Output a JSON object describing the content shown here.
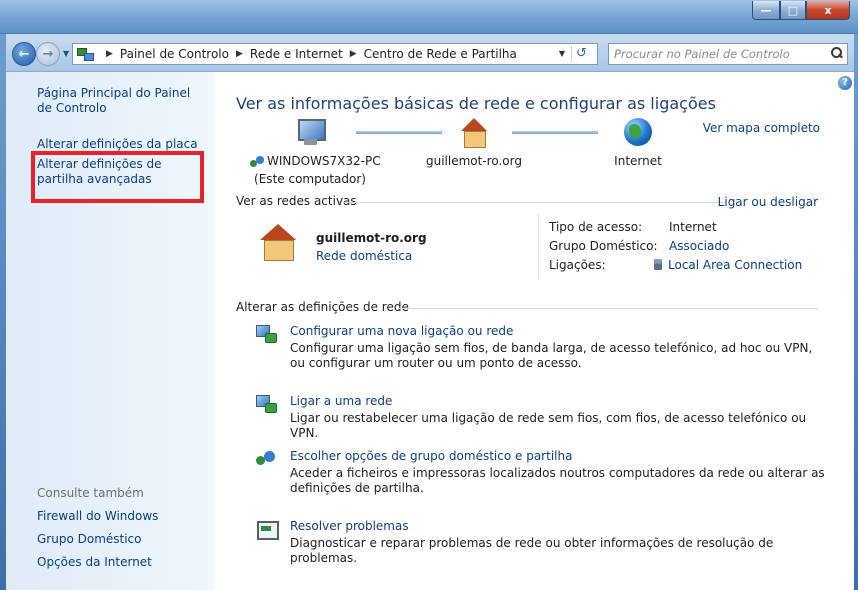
{
  "window": {
    "min_label": "",
    "max_label": "",
    "close_label": "x"
  },
  "address": {
    "crumbs": [
      "Painel de Controlo",
      "Rede e Internet",
      "Centro de Rede e Partilha"
    ],
    "search_placeholder": "Procurar no Painel de Controlo"
  },
  "left": {
    "home": "Página Principal do Painel de Controlo",
    "adapter": "Alterar definições da placa",
    "advanced": "Alterar definições de partilha avançadas",
    "see_also": "Consulte também",
    "links": [
      "Firewall do Windows",
      "Grupo Doméstico",
      "Opções da Internet"
    ]
  },
  "main": {
    "heading": "Ver as informações básicas de rede e configurar as ligações",
    "full_map": "Ver mapa completo",
    "nodes": {
      "pc_name": "WINDOWS7X32-PC",
      "pc_sub": "(Este computador)",
      "network": "guillemot-ro.org",
      "internet": "Internet"
    },
    "active_label": "Ver as redes activas",
    "connect_link": "Ligar ou desligar",
    "active": {
      "name": "guillemot-ro.org",
      "type": "Rede doméstica",
      "access_key": "Tipo de acesso:",
      "access_val": "Internet",
      "group_key": "Grupo Doméstico:",
      "group_val": "Associado",
      "conn_key": "Ligações:",
      "conn_val": "Local Area Connection"
    },
    "change_label": "Alterar as definições de rede",
    "tasks": [
      {
        "title": "Configurar uma nova ligação ou rede",
        "desc": "Configurar uma ligação sem fios, de banda larga, de acesso telefónico, ad hoc ou VPN, ou configurar um router ou um ponto de acesso."
      },
      {
        "title": "Ligar a uma rede",
        "desc": "Ligar ou restabelecer uma ligação de rede sem fios, com fios, de acesso telefónico ou VPN."
      },
      {
        "title": "Escolher opções de grupo doméstico e partilha",
        "desc": "Aceder a ficheiros e impressoras localizados noutros computadores da rede ou alterar as definições de partilha."
      },
      {
        "title": "Resolver problemas",
        "desc": "Diagnosticar e reparar problemas de rede ou obter informações de resolução de problemas."
      }
    ]
  },
  "colors": {
    "link": "#0b3d8c",
    "heading": "#1e3f7c",
    "highlight": "#e8222b"
  }
}
